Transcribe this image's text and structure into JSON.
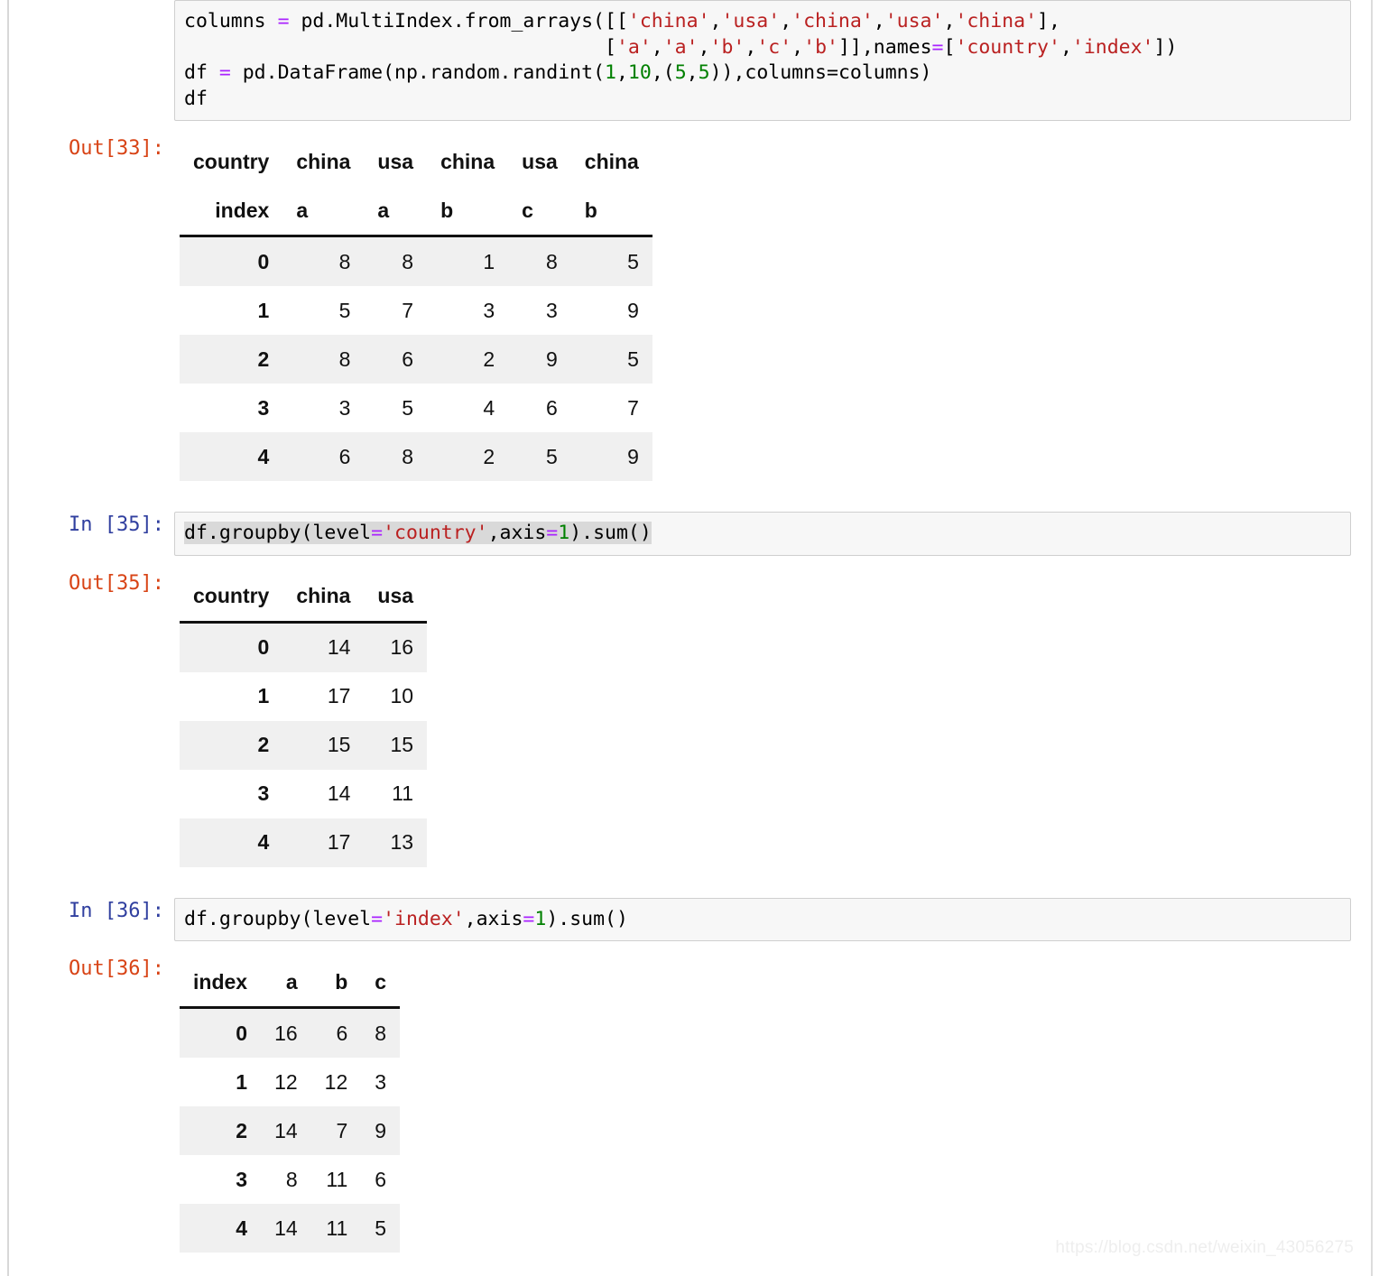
{
  "notebook": {
    "cells": [
      {
        "type": "code",
        "prompt": "",
        "source_lines": [
          "columns = pd.MultiIndex.from_arrays([['china','usa','china','usa','china'],",
          "                                    ['a','a','b','c','b']],names=['country','index'])",
          "df = pd.DataFrame(np.random.randint(1,10,(5,5)),columns=columns)",
          "df"
        ]
      },
      {
        "type": "output",
        "prompt": "Out[33]:"
      },
      {
        "type": "code",
        "prompt": "In [35]:",
        "source_lines": [
          "df.groupby(level='country',axis=1).sum()"
        ]
      },
      {
        "type": "output",
        "prompt": "Out[35]:"
      },
      {
        "type": "code",
        "prompt": "In [36]:",
        "source_lines": [
          "df.groupby(level='index',axis=1).sum()"
        ]
      },
      {
        "type": "output",
        "prompt": "Out[36]:"
      }
    ]
  },
  "prompts": {
    "out33": "Out[33]:",
    "in35": "In [35]:",
    "out35": "Out[35]:",
    "in36": "In [36]:",
    "out36": "Out[36]:"
  },
  "code": {
    "cell1": {
      "line1_a": "columns ",
      "line1_eq": "=",
      "line1_b": " pd.MultiIndex.from_arrays([[",
      "line1_s1": "'china'",
      "line1_c1": ",",
      "line1_s2": "'usa'",
      "line1_c2": ",",
      "line1_s3": "'china'",
      "line1_c3": ",",
      "line1_s4": "'usa'",
      "line1_c4": ",",
      "line1_s5": "'china'",
      "line1_end": "],",
      "line2_pad": "                                    [",
      "line2_s1": "'a'",
      "line2_c1": ",",
      "line2_s2": "'a'",
      "line2_c2": ",",
      "line2_s3": "'b'",
      "line2_c3": ",",
      "line2_s4": "'c'",
      "line2_c4": ",",
      "line2_s5": "'b'",
      "line2_mid": "]],names",
      "line2_eq": "=",
      "line2_b2": "[",
      "line2_s6": "'country'",
      "line2_c5": ",",
      "line2_s7": "'index'",
      "line2_end": "])",
      "line3_a": "df ",
      "line3_eq": "=",
      "line3_b": " pd.DataFrame(np.random.randint(",
      "line3_n1": "1",
      "line3_c1": ",",
      "line3_n2": "10",
      "line3_c2": ",(",
      "line3_n3": "5",
      "line3_c3": ",",
      "line3_n4": "5",
      "line3_end": ")),columns=columns)",
      "line4": "df"
    },
    "cell2": {
      "a": "df.groupby(level",
      "eq1": "=",
      "s1": "'country'",
      "mid": ",axis",
      "eq2": "=",
      "n1": "1",
      "end": ").sum()"
    },
    "cell3": {
      "a": "df.groupby(level",
      "eq1": "=",
      "s1": "'index'",
      "mid": ",axis",
      "eq2": "=",
      "n1": "1",
      "end": ").sum()"
    }
  },
  "table1": {
    "index_names": [
      "country",
      "index"
    ],
    "level0": [
      "china",
      "usa",
      "china",
      "usa",
      "china"
    ],
    "level1": [
      "a",
      "a",
      "b",
      "c",
      "b"
    ],
    "row_labels": [
      "0",
      "1",
      "2",
      "3",
      "4"
    ],
    "rows": [
      [
        "8",
        "8",
        "1",
        "8",
        "5"
      ],
      [
        "5",
        "7",
        "3",
        "3",
        "9"
      ],
      [
        "8",
        "6",
        "2",
        "9",
        "5"
      ],
      [
        "3",
        "5",
        "4",
        "6",
        "7"
      ],
      [
        "6",
        "8",
        "2",
        "5",
        "9"
      ]
    ]
  },
  "table2": {
    "index_name": "country",
    "columns": [
      "china",
      "usa"
    ],
    "row_labels": [
      "0",
      "1",
      "2",
      "3",
      "4"
    ],
    "rows": [
      [
        "14",
        "16"
      ],
      [
        "17",
        "10"
      ],
      [
        "15",
        "15"
      ],
      [
        "14",
        "11"
      ],
      [
        "17",
        "13"
      ]
    ]
  },
  "table3": {
    "index_name": "index",
    "columns": [
      "a",
      "b",
      "c"
    ],
    "row_labels": [
      "0",
      "1",
      "2",
      "3",
      "4"
    ],
    "rows": [
      [
        "16",
        "6",
        "8"
      ],
      [
        "12",
        "12",
        "3"
      ],
      [
        "14",
        "7",
        "9"
      ],
      [
        "8",
        "11",
        "6"
      ],
      [
        "14",
        "11",
        "5"
      ]
    ]
  },
  "watermark": {
    "text": "https://blog.csdn.net/weixin_43056275"
  },
  "colors": {
    "string": "#ba2121",
    "operator": "#aa22ff",
    "number": "#008000",
    "in_prompt": "#303f9f",
    "out_prompt": "#d84315",
    "code_bg": "#f7f7f7",
    "code_border": "#cfcfcf",
    "row_stripe": "#f0f0f0",
    "selection": "#d9d9d9"
  }
}
